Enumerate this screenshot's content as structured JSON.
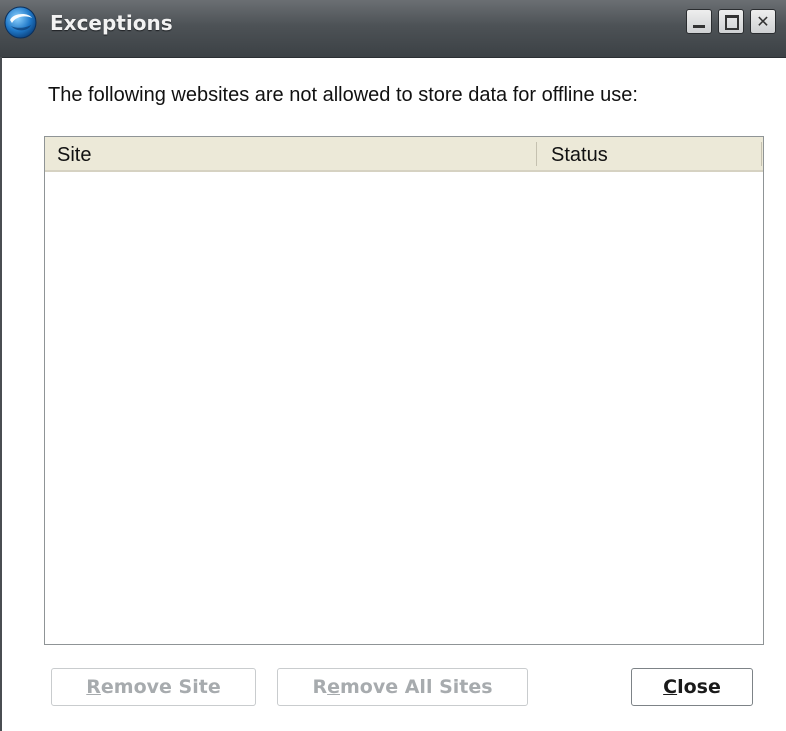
{
  "window": {
    "title": "Exceptions",
    "icon": "opera-logo-icon"
  },
  "titlebar_controls": {
    "minimize_icon": "minimize-icon",
    "maximize_icon": "maximize-icon",
    "close_icon": "close-icon",
    "close_glyph": "✕"
  },
  "dialog": {
    "description": "The following websites are not allowed to store data for offline use:"
  },
  "table": {
    "columns": [
      "Site",
      "Status"
    ],
    "rows": []
  },
  "buttons": {
    "remove_site": {
      "accel": "R",
      "rest": "emove Site",
      "enabled": false
    },
    "remove_all_sites": {
      "pre": "R",
      "accel": "e",
      "rest": "move All Sites",
      "enabled": false
    },
    "close": {
      "accel": "C",
      "rest": "lose",
      "enabled": true
    }
  },
  "colors": {
    "titlebar": "#4d5256",
    "header_bg": "#ece9d8",
    "disabled_text": "#a7abae"
  }
}
